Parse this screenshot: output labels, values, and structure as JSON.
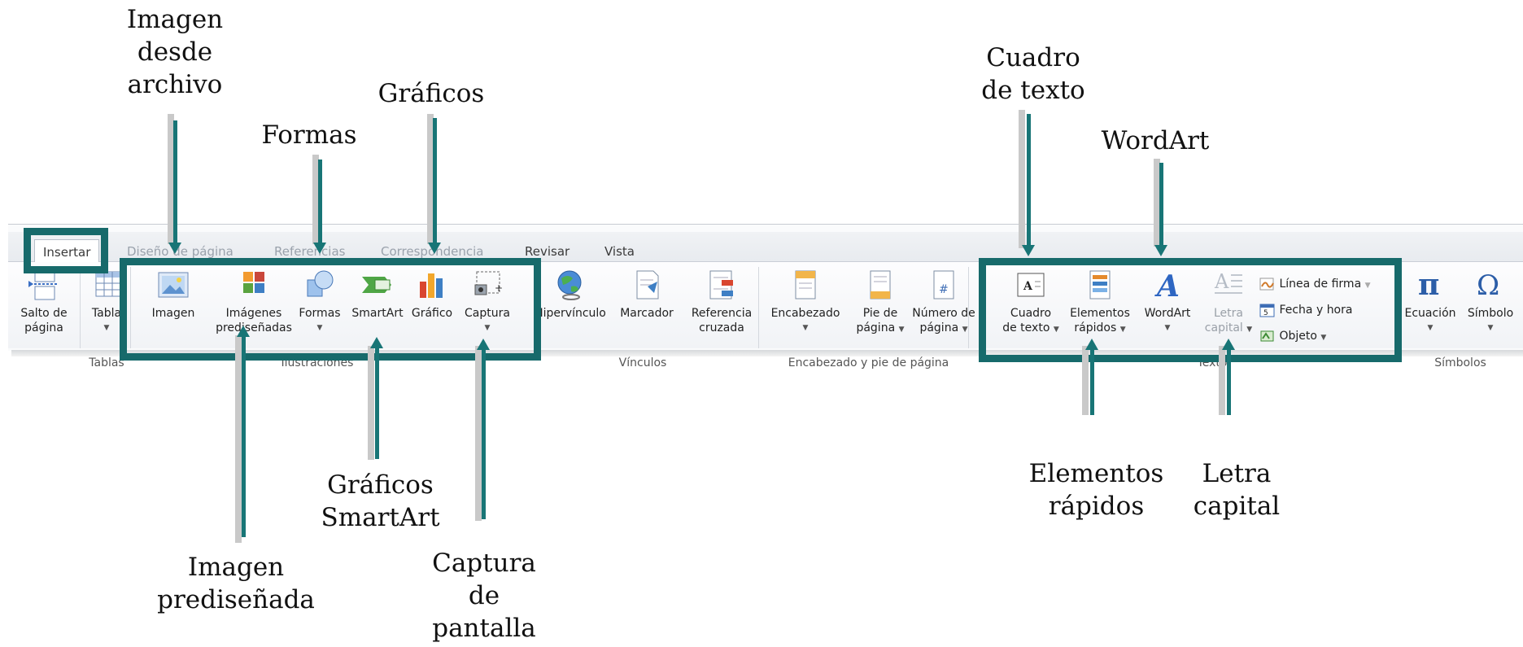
{
  "ribbon": {
    "tabs": [
      {
        "label": "Insertar",
        "state": "active"
      },
      {
        "label": "Diseño de página",
        "state": "faded"
      },
      {
        "label": "Referencias",
        "state": "faded"
      },
      {
        "label": "Correspondencia",
        "state": "faded"
      },
      {
        "label": "Revisar",
        "state": "normal"
      },
      {
        "label": "Vista",
        "state": "normal"
      }
    ],
    "groups": {
      "paginas": {
        "salto_line1": "Salto de",
        "salto_line2": "página"
      },
      "tablas": {
        "tabla_label": "Tabla",
        "group_label": "Tablas"
      },
      "ilustraciones": {
        "group_label": "Ilustraciones",
        "imagen": "Imagen",
        "imagenes_line1": "Imágenes",
        "imagenes_line2": "prediseñadas",
        "formas": "Formas",
        "smartart": "SmartArt",
        "grafico": "Gráfico",
        "captura": "Captura"
      },
      "vinculos": {
        "group_label": "Vínculos",
        "hipervinculo": "Hipervínculo",
        "marcador": "Marcador",
        "referencia_line1": "Referencia",
        "referencia_line2": "cruzada"
      },
      "encabezado": {
        "group_label": "Encabezado y pie de página",
        "encabezado": "Encabezado",
        "pie_line1": "Pie de",
        "pie_line2": "página",
        "numero_line1": "Número de",
        "numero_line2": "página"
      },
      "texto": {
        "group_label": "Texto",
        "cuadro_line1": "Cuadro",
        "cuadro_line2": "de texto",
        "elementos_line1": "Elementos",
        "elementos_line2": "rápidos",
        "wordart": "WordArt",
        "letra_line1": "Letra",
        "letra_line2": "capital",
        "linea_firma": "Línea de firma",
        "fecha_hora": "Fecha y hora",
        "objeto": "Objeto"
      },
      "simbolos": {
        "group_label": "Símbolos",
        "ecuacion": "Ecuación",
        "simbolo": "Símbolo"
      }
    }
  },
  "annotations": {
    "imagen_desde_archivo": [
      "Imagen",
      "desde",
      "archivo"
    ],
    "graficos": "Gráficos",
    "formas": "Formas",
    "cuadro_de_texto": [
      "Cuadro",
      "de texto"
    ],
    "wordart": "WordArt",
    "imagen_predisenada": [
      "Imagen",
      "prediseñada"
    ],
    "graficos_smartart": [
      "Gráficos",
      "SmartArt"
    ],
    "captura_de_pantalla": [
      "Captura",
      "de",
      "pantalla"
    ],
    "elementos_rapidos": [
      "Elementos",
      "rápidos"
    ],
    "letra_capital": [
      "Letra",
      "capital"
    ]
  },
  "colors": {
    "highlight": "#176a6b",
    "arrow": "#187576"
  },
  "icons": [
    "page-break-icon",
    "table-icon",
    "picture-icon",
    "clipart-icon",
    "shapes-icon",
    "smartart-icon",
    "chart-icon",
    "screenshot-icon",
    "hyperlink-globe-icon",
    "bookmark-icon",
    "cross-reference-icon",
    "header-icon",
    "footer-icon",
    "page-number-icon",
    "textbox-icon",
    "quickparts-icon",
    "wordart-icon",
    "dropcap-icon",
    "signature-line-icon",
    "date-time-icon",
    "object-icon",
    "pi-icon",
    "omega-icon"
  ]
}
